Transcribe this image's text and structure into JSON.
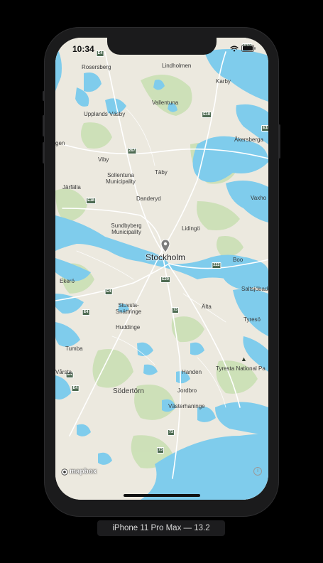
{
  "status_bar": {
    "time": "10:34",
    "battery_icon": "battery-icon",
    "wifi_icon": "wifi-icon"
  },
  "map": {
    "city": "Stockholm",
    "labels": {
      "rosersberg": "Rosersberg",
      "lindholmen": "Lindholmen",
      "karby": "Karby",
      "vallentuna": "Vallentuna",
      "upplands_vasby": "Upplands Väsby",
      "akersberga": "Åkersberga",
      "viby": "Viby",
      "taby": "Täby",
      "sollentuna": "Sollentuna\nMunicipality",
      "jarfalla": "Järfälla",
      "danderyd": "Danderyd",
      "vaxholm": "Vaxho",
      "sundbyberg": "Sundbyberg\nMunicipality",
      "lidingo": "Lidingö",
      "boo": "Boo",
      "ekero": "Ekerö",
      "saltsjobaden": "Saltsjöbade",
      "stuvsta": "Stuvsta-\nSnättringe",
      "alta": "Älta",
      "tyreso": "Tyresö",
      "huddinge": "Huddinge",
      "tumba": "Tumba",
      "tyresta": "Tyresta National Pa",
      "varsta": "Vårsta",
      "handen": "Handen",
      "sodertorn": "Södertörn",
      "jordbro": "Jordbro",
      "vasterhaninge": "Västerhaninge",
      "edge_gen": "gen"
    },
    "road_shields": [
      "E4",
      "E18",
      "E18",
      "267",
      "E18",
      "E18",
      "222",
      "E4",
      "E4",
      "E20",
      "73",
      "E4",
      "E4",
      "73",
      "73"
    ],
    "attribution": "mapbox",
    "info_symbol": "i"
  },
  "device_caption": "iPhone 11 Pro Max — 13.2",
  "colors": {
    "water": "#7fccec",
    "land": "#ece9df",
    "park": "#c8dfb2",
    "road": "#ffffff",
    "shield": "#4e6b52"
  }
}
